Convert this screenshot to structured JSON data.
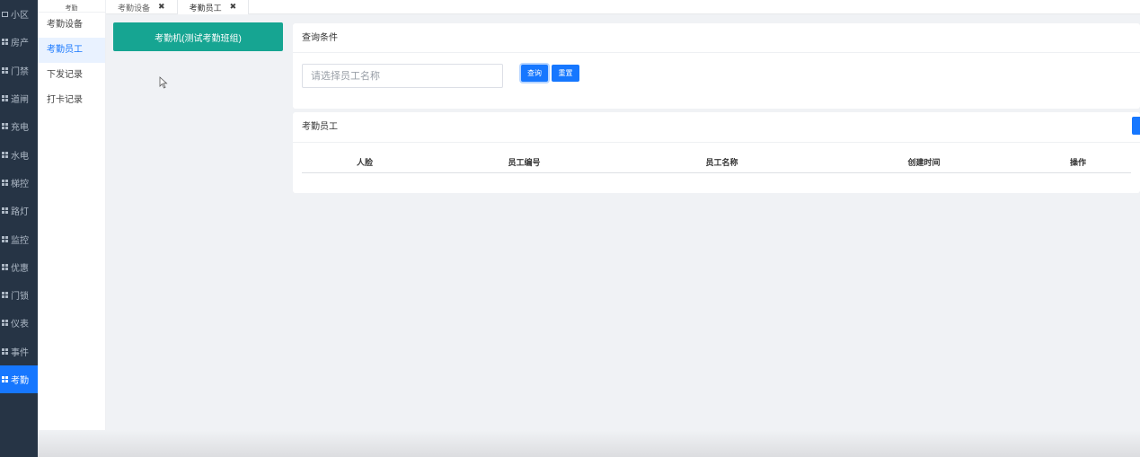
{
  "nav": {
    "items": [
      {
        "label": "小区",
        "icon": "monitor-icon"
      },
      {
        "label": "房产",
        "icon": "grid-icon"
      },
      {
        "label": "门禁",
        "icon": "grid-icon"
      },
      {
        "label": "道闸",
        "icon": "grid-icon"
      },
      {
        "label": "充电",
        "icon": "grid-icon"
      },
      {
        "label": "水电",
        "icon": "grid-icon"
      },
      {
        "label": "梯控",
        "icon": "grid-icon"
      },
      {
        "label": "路灯",
        "icon": "grid-icon"
      },
      {
        "label": "监控",
        "icon": "grid-icon"
      },
      {
        "label": "优惠",
        "icon": "grid-icon"
      },
      {
        "label": "门锁",
        "icon": "grid-icon"
      },
      {
        "label": "仪表",
        "icon": "grid-icon"
      },
      {
        "label": "事件",
        "icon": "grid-icon"
      },
      {
        "label": "考勤",
        "icon": "grid-icon",
        "active": true
      }
    ]
  },
  "submenu": {
    "title": "考勤",
    "items": [
      {
        "label": "考勤设备"
      },
      {
        "label": "考勤员工",
        "active": true
      },
      {
        "label": "下发记录"
      },
      {
        "label": "打卡记录"
      }
    ]
  },
  "tabs": [
    {
      "label": "考勤设备",
      "close": "✖"
    },
    {
      "label": "考勤员工",
      "close": "✖",
      "active": true
    }
  ],
  "device_button": {
    "label": "考勤机(测试考勤班组)"
  },
  "query": {
    "title": "查询条件",
    "input_placeholder": "请选择员工名称",
    "search_label": "查询",
    "reset_label": "重置"
  },
  "list": {
    "title": "考勤员工",
    "columns": [
      "人脸",
      "员工编号",
      "员工名称",
      "创建时间",
      "操作"
    ]
  },
  "colors": {
    "nav_bg": "#263445",
    "accent": "#1677ff",
    "device_button": "#16a592"
  }
}
